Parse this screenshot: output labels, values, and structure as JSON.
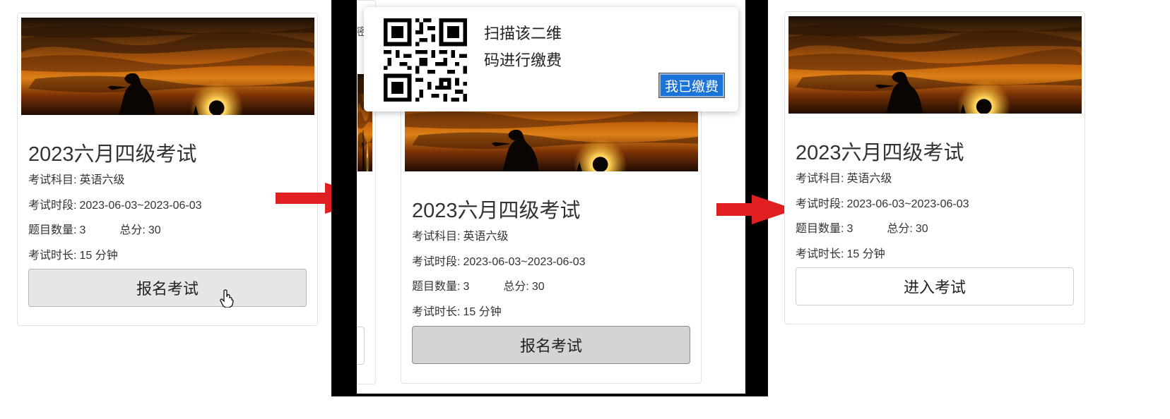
{
  "colors": {
    "arrow": "#e02020",
    "paid_button": "#1a73d9",
    "card_border": "#e2e2e2",
    "button_gray": "#e6e6e6"
  },
  "left_card": {
    "title": "2023六月四级考试",
    "subject_label": "考试科目:",
    "subject_value": "英语六级",
    "period_label": "考试时段:",
    "period_value": "2023-06-03~2023-06-03",
    "count_label": "题目数量:",
    "count_value": "3",
    "total_label": "总分:",
    "total_value": "30",
    "duration_label": "考试时长:",
    "duration_value": "15 分钟",
    "button_label": "报名考试",
    "cursor_icon": "hand-pointer-icon"
  },
  "middle_panel": {
    "popup": {
      "qr_icon": "qr-code-icon",
      "text_line1": "扫描该二维",
      "text_line2": "码进行缴费",
      "paid_button_label": "我已缴费"
    },
    "partial_text": "密",
    "card": {
      "title": "2023六月四级考试",
      "subject_label": "考试科目:",
      "subject_value": "英语六级",
      "period_label": "考试时段:",
      "period_value": "2023-06-03~2023-06-03",
      "count_label": "题目数量:",
      "count_value": "3",
      "total_label": "总分:",
      "total_value": "30",
      "duration_label": "考试时长:",
      "duration_value": "15 分钟",
      "button_label": "报名考试"
    }
  },
  "right_card": {
    "title": "2023六月四级考试",
    "subject_label": "考试科目:",
    "subject_value": "英语六级",
    "period_label": "考试时段:",
    "period_value": "2023-06-03~2023-06-03",
    "count_label": "题目数量:",
    "count_value": "3",
    "total_label": "总分:",
    "total_value": "30",
    "duration_label": "考试时长:",
    "duration_value": "15 分钟",
    "button_label": "进入考试"
  }
}
